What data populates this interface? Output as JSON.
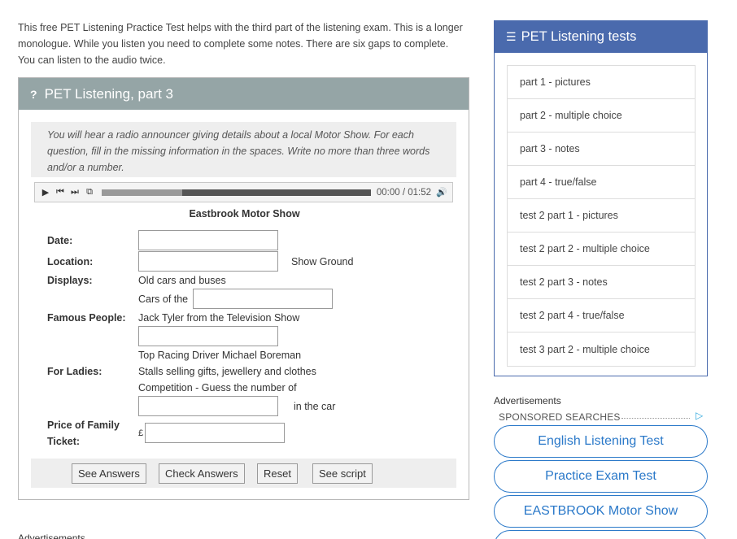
{
  "intro": "This free PET Listening Practice Test helps with the third part of the listening exam. This is a longer monologue. While you listen you need to complete some notes. There are six gaps to complete. You can listen to the audio twice.",
  "panel": {
    "icon": "question-icon",
    "title": "PET Listening, part 3",
    "instructions": "You will hear a radio announcer giving details about a local Motor Show. For each question, fill in the missing information in the spaces. Write no more than three words and/or a number."
  },
  "player": {
    "play": "▶",
    "prev": "⏮",
    "next": "⏭",
    "loop": "⧉",
    "time": "00:00 / 01:52",
    "volume": "🔊",
    "buffered_fraction": 0.3
  },
  "form": {
    "title": "Eastbrook Motor Show",
    "date_label": "Date:",
    "location_label": "Location:",
    "location_suffix": "Show Ground",
    "displays_label": "Displays:",
    "displays_line1": "Old cars and buses",
    "displays_line2": "Cars of the",
    "famous_label": "Famous People:",
    "famous_line1": "Jack Tyler from the Television Show",
    "famous_line2": "Top Racing Driver Michael Boreman",
    "ladies_label": "For Ladies:",
    "ladies_line1": "Stalls selling gifts, jewellery and clothes",
    "ladies_line2": "Competition - Guess the number of",
    "ladies_suffix": "in the car",
    "price_label_1": "Price of Family",
    "price_label_2": "Ticket:",
    "currency": "£"
  },
  "buttons": {
    "see_answers": "See Answers",
    "check_answers": "Check Answers",
    "reset": "Reset",
    "see_script": "See script"
  },
  "sidebar": {
    "title": "PET Listening tests",
    "icon": "list-icon",
    "items": [
      "part 1 - pictures",
      "part 2 - multiple choice",
      "part 3 - notes",
      "part 4 - true/false",
      "test 2 part 1 - pictures",
      "test 2 part 2 - multiple choice",
      "test 2 part 3 - notes",
      "test 2 part 4 - true/false",
      "test 3 part 2 - multiple choice"
    ]
  },
  "ads": {
    "label": "Advertisements",
    "sponsored": "SPONSORED SEARCHES",
    "adchoices_icon": "adchoices-icon",
    "buttons": [
      "English Listening Test",
      "Practice Exam Test",
      "EASTBROOK Motor Show"
    ],
    "bottom_label": "Advertisements"
  },
  "colors": {
    "panel_header": "#95a5a6",
    "sidebar_header": "#4a6aad",
    "ad_blue": "#2b79c9"
  }
}
